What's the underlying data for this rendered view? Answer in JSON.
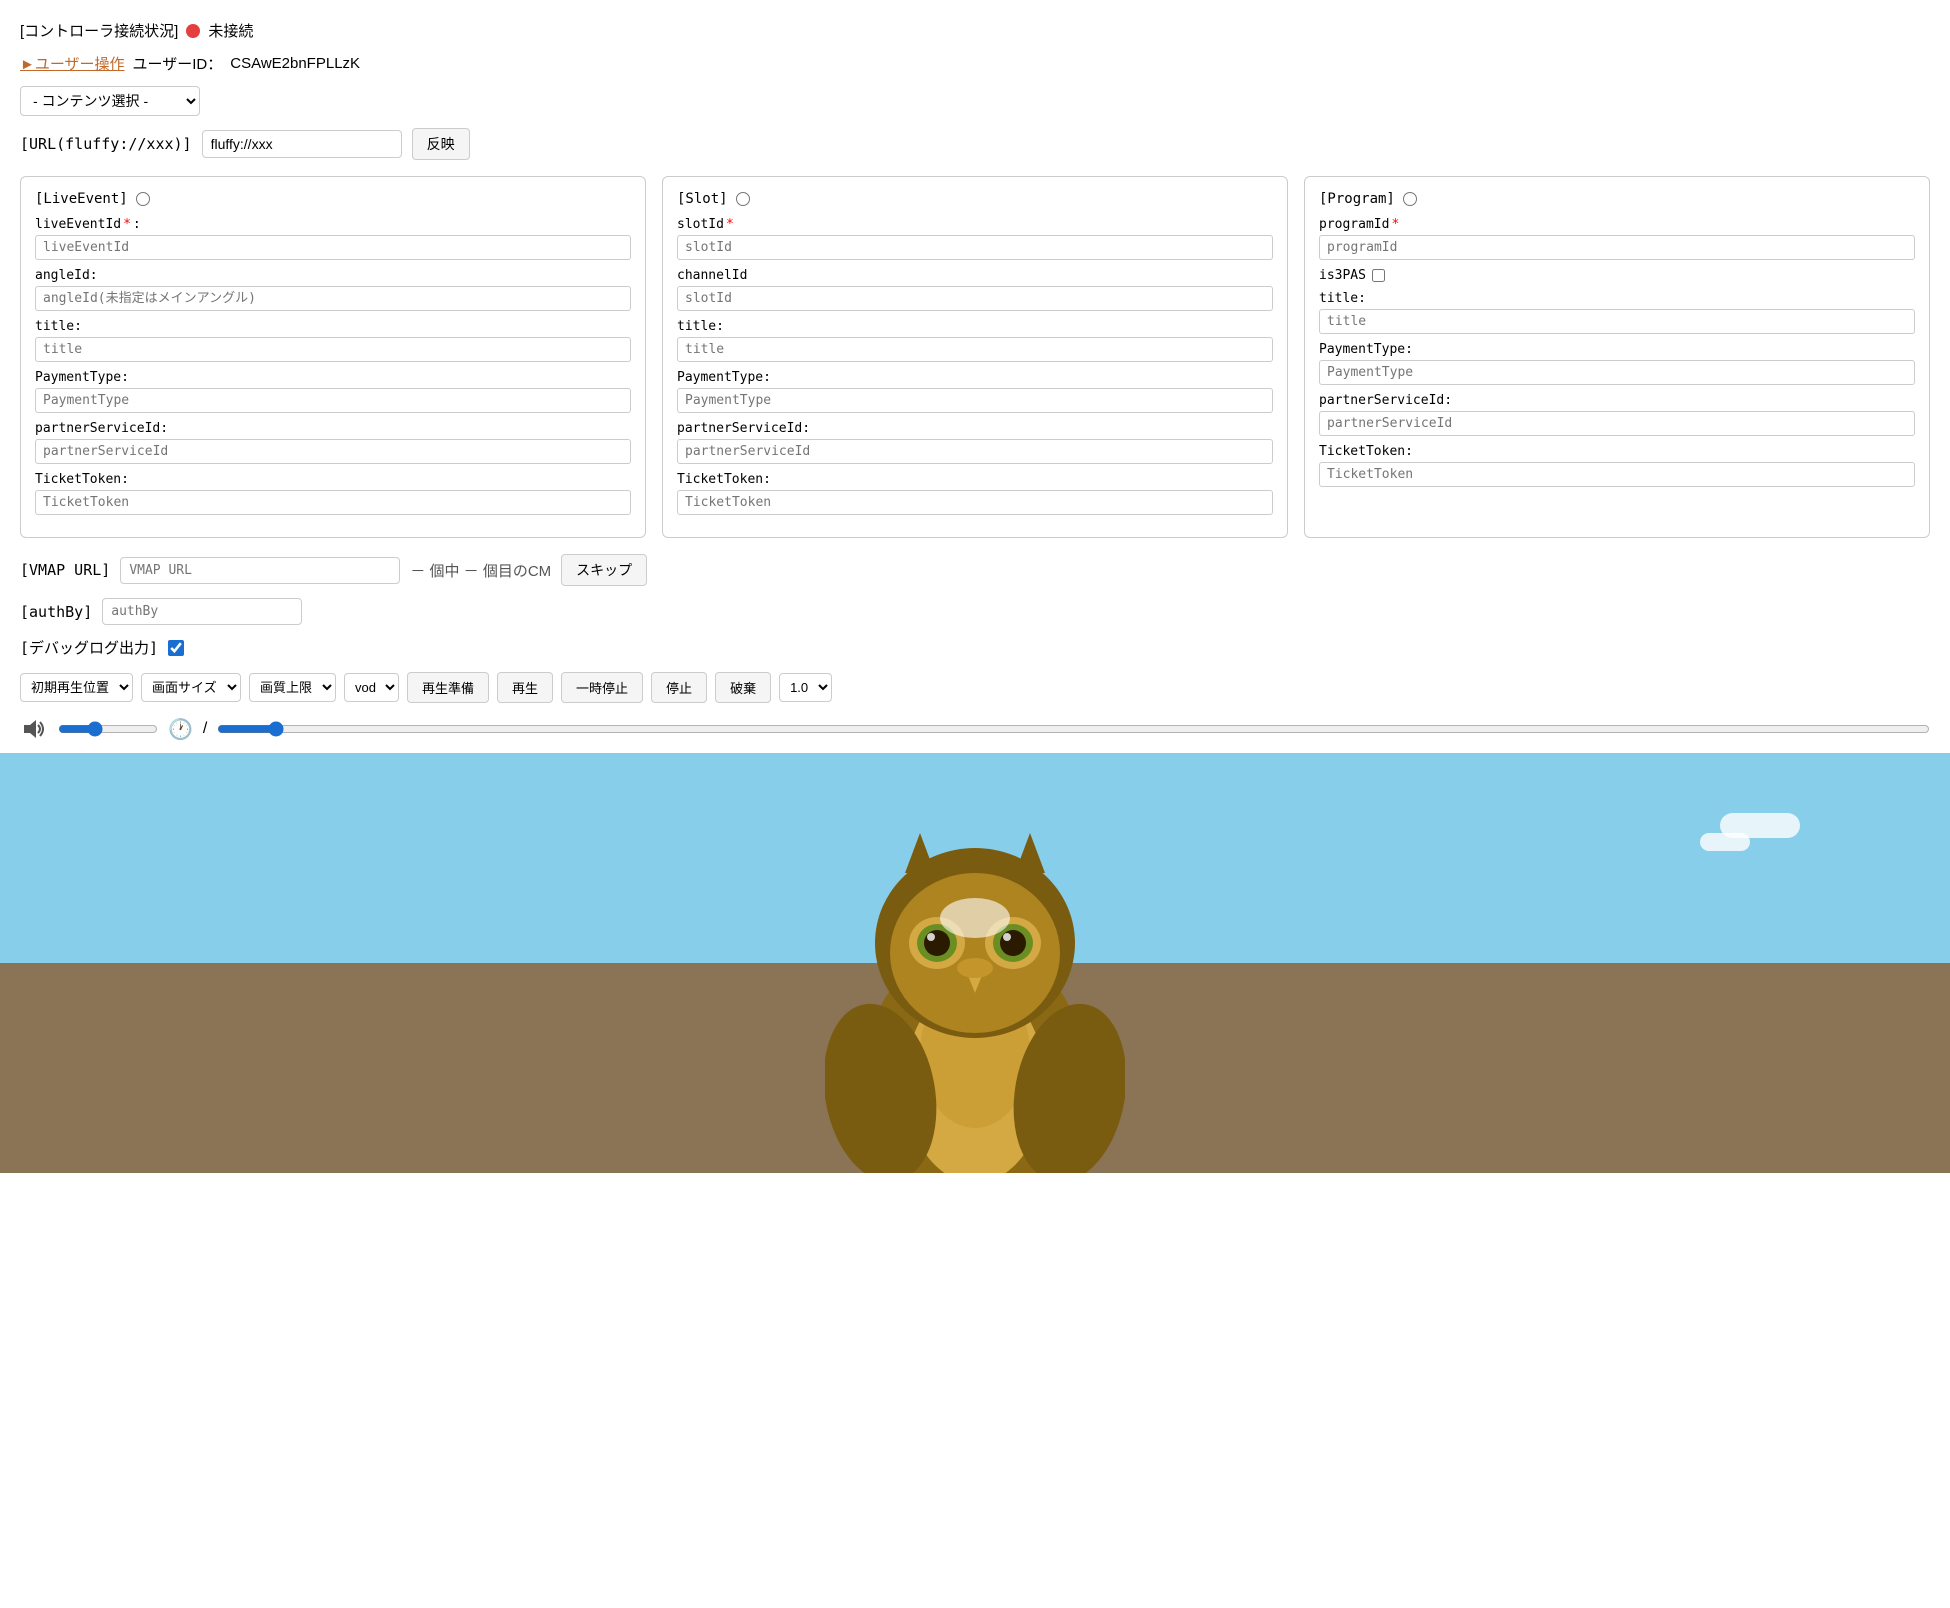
{
  "status": {
    "label": "[コントローラ接続状況]",
    "dot_color": "#e53e3e",
    "status_text": "未接続"
  },
  "user": {
    "link_label": "►ユーザー操作",
    "user_id_label": "ユーザーID：",
    "user_id": "CSAwE2bnFPLLzK"
  },
  "content_select": {
    "placeholder": "- コンテンツ選択 -",
    "options": [
      "- コンテンツ選択 -"
    ]
  },
  "url_section": {
    "label": "[URL(fluffy://xxx)]",
    "input_value": "fluffy://xxx",
    "button_label": "反映"
  },
  "live_event_panel": {
    "title": "[LiveEvent]",
    "fields": [
      {
        "label": "liveEventId",
        "required": true,
        "placeholder": "liveEventId"
      },
      {
        "label": "angleId:",
        "required": false,
        "placeholder": "angleId(未指定はメインアングル)"
      },
      {
        "label": "title:",
        "required": false,
        "placeholder": "title"
      },
      {
        "label": "PaymentType:",
        "required": false,
        "placeholder": "PaymentType"
      },
      {
        "label": "partnerServiceId:",
        "required": false,
        "placeholder": "partnerServiceId"
      },
      {
        "label": "TicketToken:",
        "required": false,
        "placeholder": "TicketToken"
      }
    ]
  },
  "slot_panel": {
    "title": "[Slot]",
    "fields": [
      {
        "label": "slotId",
        "required": true,
        "placeholder": "slotId"
      },
      {
        "label": "channelId",
        "required": false,
        "placeholder": "slotId"
      },
      {
        "label": "title:",
        "required": false,
        "placeholder": "title"
      },
      {
        "label": "PaymentType:",
        "required": false,
        "placeholder": "PaymentType"
      },
      {
        "label": "partnerServiceId:",
        "required": false,
        "placeholder": "partnerServiceId"
      },
      {
        "label": "TicketToken:",
        "required": false,
        "placeholder": "TicketToken"
      }
    ]
  },
  "program_panel": {
    "title": "[Program]",
    "fields": [
      {
        "label": "programId",
        "required": true,
        "placeholder": "programId"
      },
      {
        "label": "is3PAS",
        "is_checkbox": true
      },
      {
        "label": "title:",
        "required": false,
        "placeholder": "title"
      },
      {
        "label": "PaymentType:",
        "required": false,
        "placeholder": "PaymentType"
      },
      {
        "label": "partnerServiceId:",
        "required": false,
        "placeholder": "partnerServiceId"
      },
      {
        "label": "TicketToken:",
        "required": false,
        "placeholder": "TicketToken"
      }
    ]
  },
  "vmap": {
    "label": "[VMAP URL]",
    "placeholder": "VMAP URL",
    "count_text": "－ 個中 － 個目のCM",
    "skip_label": "スキップ"
  },
  "authby": {
    "label": "[authBy]",
    "placeholder": "authBy"
  },
  "debug": {
    "label": "[デバッグログ出力]",
    "checked": true
  },
  "controls": {
    "playback_position": {
      "label": "初期再生位置",
      "options": [
        "初期再生位置"
      ]
    },
    "screen_size": {
      "label": "画面サイズ",
      "options": [
        "画面サイズ"
      ]
    },
    "quality": {
      "label": "画質上限",
      "options": [
        "画質上限"
      ]
    },
    "mode": {
      "label": "vod",
      "options": [
        "vod"
      ]
    },
    "prepare_label": "再生準備",
    "play_label": "再生",
    "pause_label": "一時停止",
    "stop_label": "停止",
    "discard_label": "破棄",
    "speed_label": "1.0",
    "speed_options": [
      "1.0"
    ]
  },
  "video": {
    "has_owl": true
  }
}
